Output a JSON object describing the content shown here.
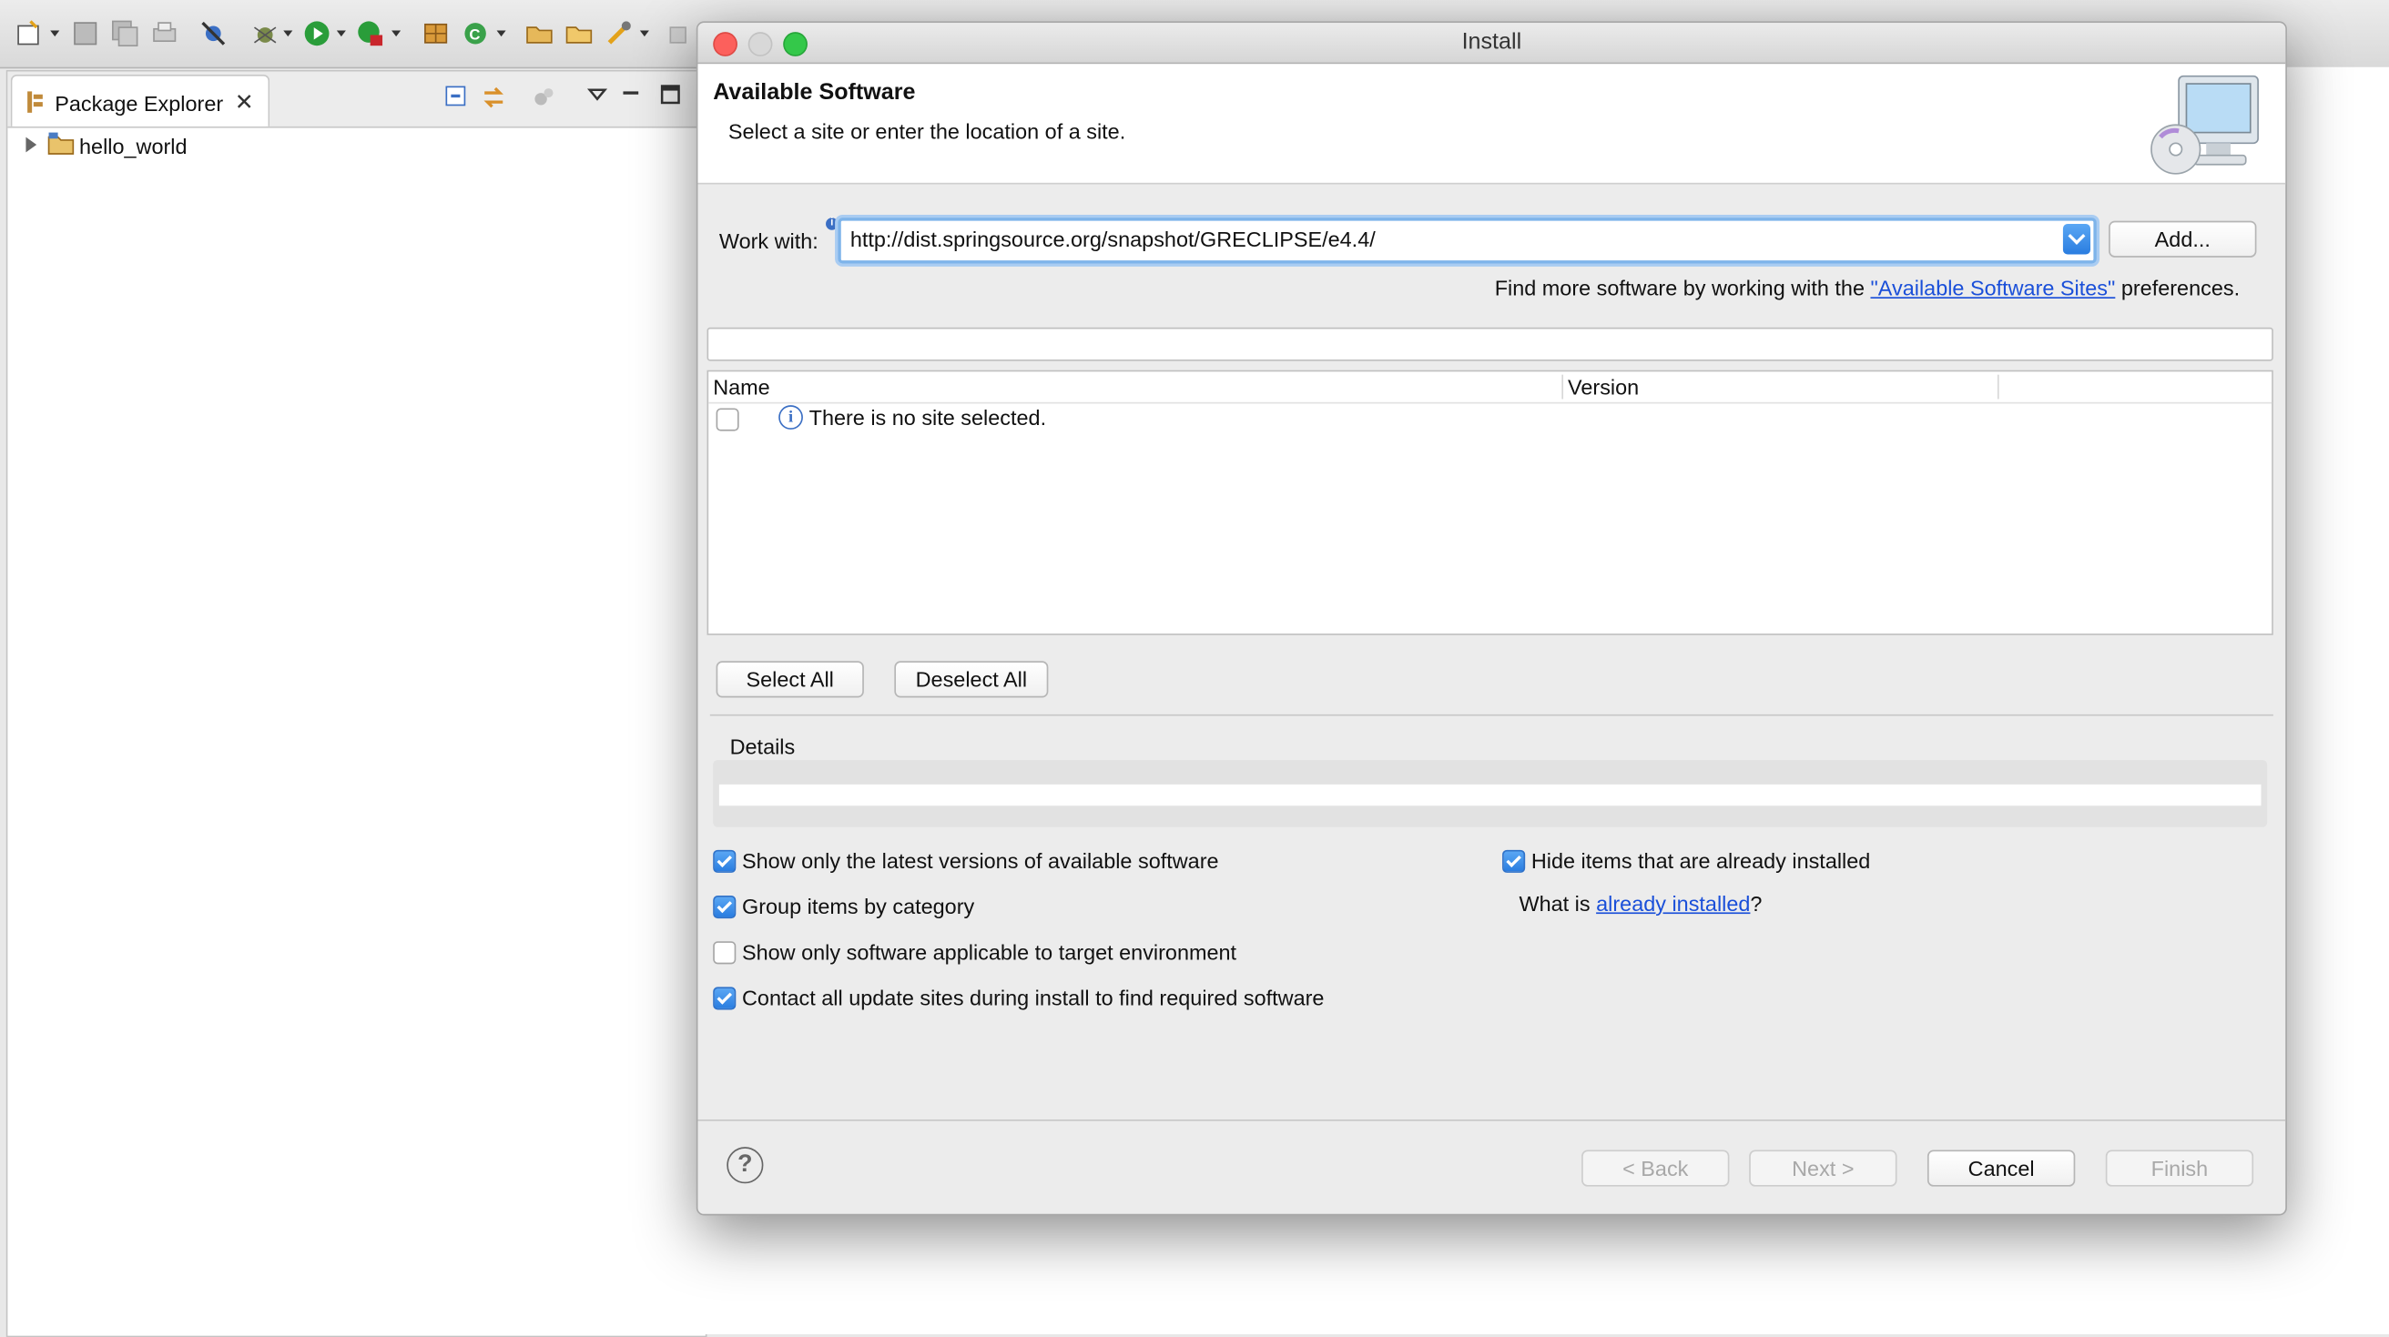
{
  "workbench": {
    "package_explorer": {
      "tab_label": "Package Explorer",
      "tree": [
        {
          "label": "hello_world"
        }
      ]
    }
  },
  "dialog": {
    "title": "Install",
    "banner": {
      "title": "Available Software",
      "message": "Select a site or enter the location of a site."
    },
    "work_with_label": "Work with:",
    "work_with_value": "http://dist.springsource.org/snapshot/GRECLIPSE/e4.4/",
    "add_button": "Add...",
    "find_more_prefix": "Find more software by working with the",
    "find_more_link": "\"Available Software Sites\"",
    "find_more_suffix": "preferences.",
    "filter_value": "",
    "table": {
      "columns": [
        "Name",
        "Version"
      ],
      "rows": [
        {
          "name": "There is no site selected.",
          "checked": false
        }
      ]
    },
    "select_all": "Select All",
    "deselect_all": "Deselect All",
    "details_label": "Details",
    "options_left": [
      {
        "label": "Show only the latest versions of available software",
        "checked": true
      },
      {
        "label": "Group items by category",
        "checked": true
      },
      {
        "label": "Show only software applicable to target environment",
        "checked": false
      },
      {
        "label": "Contact all update sites during install to find required software",
        "checked": true
      }
    ],
    "options_right": {
      "hide_installed": {
        "label": "Hide items that are already installed",
        "checked": true
      },
      "what_is_prefix": "What is",
      "what_is_link": "already installed",
      "what_is_suffix": "?"
    },
    "footer": {
      "help": "?",
      "back": "< Back",
      "next": "Next >",
      "cancel": "Cancel",
      "finish": "Finish"
    }
  },
  "colors": {
    "accent": "#2a7de0",
    "link": "#1a4fd9",
    "close": "#fc605c",
    "zoom": "#34c84a"
  }
}
